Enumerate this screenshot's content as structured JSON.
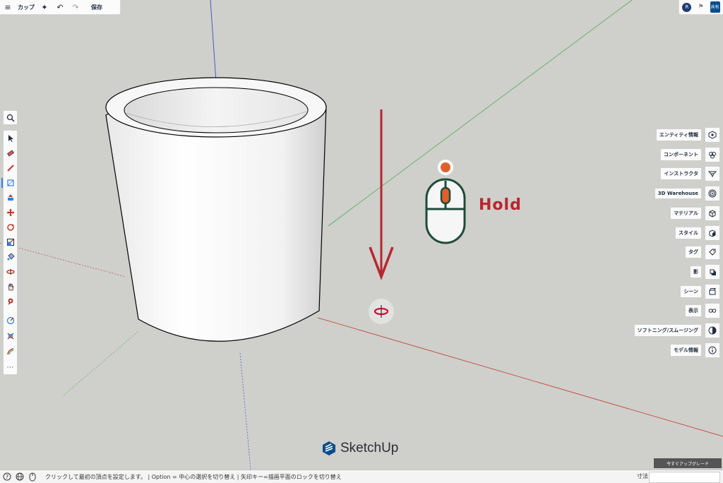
{
  "toolbar": {
    "menu_icon": "≡",
    "title": "カップ",
    "ai_icon": "✦",
    "undo_icon": "↶",
    "redo_icon": "↷",
    "save_label": "保存"
  },
  "top_right": {
    "avatar_initial": "R",
    "share_label": "共有"
  },
  "tools": [
    {
      "name": "select-icon"
    },
    {
      "name": "eraser-icon"
    },
    {
      "name": "pencil-icon"
    },
    {
      "name": "rectangle-icon"
    },
    {
      "name": "push-pull-icon"
    },
    {
      "name": "move-icon"
    },
    {
      "name": "rotate-icon"
    },
    {
      "name": "scale-icon"
    },
    {
      "name": "paint-bucket-icon"
    },
    {
      "name": "orbit-icon"
    },
    {
      "name": "pan-icon"
    },
    {
      "name": "walk-icon"
    },
    {
      "name": "tape-measure-icon"
    },
    {
      "name": "section-plane-icon"
    },
    {
      "name": "follow-me-icon"
    }
  ],
  "more_tools": "⋯",
  "panels": [
    {
      "label": "エンティティ情報",
      "icon": "entity-info-icon"
    },
    {
      "label": "コンポーネント",
      "icon": "components-icon"
    },
    {
      "label": "インストラクタ",
      "icon": "instructor-icon"
    },
    {
      "label": "3D Warehouse",
      "icon": "warehouse-icon"
    },
    {
      "label": "マテリアル",
      "icon": "materials-icon"
    },
    {
      "label": "スタイル",
      "icon": "styles-icon"
    },
    {
      "label": "タグ",
      "icon": "tags-icon"
    },
    {
      "label": "影",
      "icon": "shadows-icon"
    },
    {
      "label": "シーン",
      "icon": "scenes-icon"
    },
    {
      "label": "表示",
      "icon": "display-icon"
    },
    {
      "label": "ソフトニング/スムージング",
      "icon": "soften-smooth-icon"
    },
    {
      "label": "モデル情報",
      "icon": "model-info-icon"
    }
  ],
  "upgrade_label": "今すぐアップグレード",
  "brand": "SketchUp",
  "hold_label": "Hold",
  "status": {
    "text": "クリックして最初の頂点を設定します。 | Option = 中心の選択を切り替え | 矢印キー=描画平面のロックを切り替え",
    "measure_label": "寸法",
    "measure_value": ""
  },
  "colors": {
    "hold_red": "#b8262e",
    "mouse_green": "#1f4b3a",
    "dot_orange": "#e0602b",
    "axis_red": "#c0392b",
    "axis_green": "#4caf50",
    "axis_blue": "#2b3fbf",
    "accent_blue": "#2f80ed"
  }
}
